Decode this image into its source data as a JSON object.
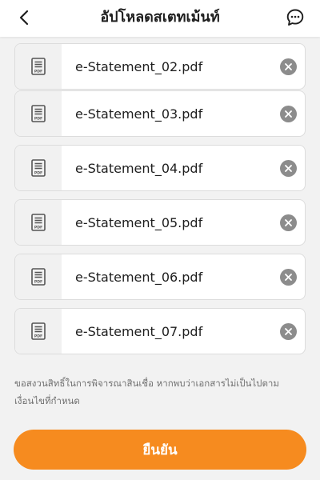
{
  "header": {
    "title": "อัปโหลดสเตทเม้นท์",
    "back_icon": "chevron-left-icon",
    "chat_icon": "chat-bubble-icon"
  },
  "files": [
    {
      "name": "e-Statement_02.pdf"
    },
    {
      "name": "e-Statement_03.pdf"
    },
    {
      "name": "e-Statement_04.pdf"
    },
    {
      "name": "e-Statement_05.pdf"
    },
    {
      "name": "e-Statement_06.pdf"
    },
    {
      "name": "e-Statement_07.pdf"
    }
  ],
  "file_icon_label": "PDF",
  "note": "ขอสงวนสิทธิ์ในการพิจารณาสินเชื่อ หากพบว่าเอกสารไม่เป็นไปตามเงื่อนไขที่กำหนด",
  "confirm_label": "ยืนยัน",
  "colors": {
    "accent": "#f68b1f",
    "remove_icon": "#8c8c8c"
  }
}
